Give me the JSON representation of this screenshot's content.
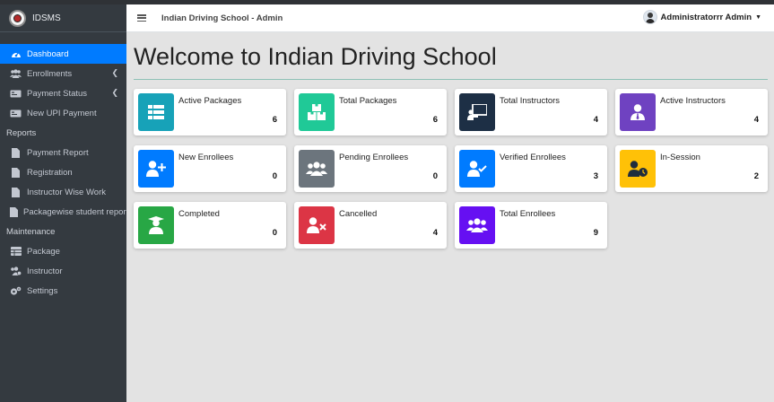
{
  "brand": {
    "name": "IDSMS"
  },
  "sidebar": {
    "items": [
      {
        "label": "Dashboard",
        "icon": "dashboard-icon"
      },
      {
        "label": "Enrollments",
        "icon": "users-icon"
      },
      {
        "label": "Payment Status",
        "icon": "payment-icon"
      },
      {
        "label": "New UPI Payment",
        "icon": "upi-icon"
      }
    ],
    "reports_header": "Reports",
    "reports": [
      {
        "label": "Payment Report",
        "icon": "file-icon"
      },
      {
        "label": "Registration",
        "icon": "file-icon"
      },
      {
        "label": "Instructor Wise Work",
        "icon": "file-icon"
      },
      {
        "label": "Packagewise student report",
        "icon": "file-icon"
      }
    ],
    "maintenance_header": "Maintenance",
    "maintenance": [
      {
        "label": "Package",
        "icon": "table-icon"
      },
      {
        "label": "Instructor",
        "icon": "users-cog-icon"
      },
      {
        "label": "Settings",
        "icon": "cogs-icon"
      }
    ]
  },
  "header": {
    "title": "Indian Driving School - Admin",
    "user": "Administratorrr Admin"
  },
  "main": {
    "title": "Welcome to Indian Driving School",
    "cards": [
      {
        "label": "Active Packages",
        "value": "6",
        "color": "#17a2b8"
      },
      {
        "label": "Total Packages",
        "value": "6",
        "color": "#20c997"
      },
      {
        "label": "Total Instructors",
        "value": "4",
        "color": "#1d2f45"
      },
      {
        "label": "Active Instructors",
        "value": "4",
        "color": "#6f42c1"
      },
      {
        "label": "New Enrollees",
        "value": "0",
        "color": "#007bff"
      },
      {
        "label": "Pending Enrollees",
        "value": "0",
        "color": "#6c757d"
      },
      {
        "label": "Verified Enrollees",
        "value": "3",
        "color": "#007bff"
      },
      {
        "label": "In-Session",
        "value": "2",
        "color": "#ffc107"
      },
      {
        "label": "Completed",
        "value": "0",
        "color": "#28a745"
      },
      {
        "label": "Cancelled",
        "value": "4",
        "color": "#dc3545"
      },
      {
        "label": "Total Enrollees",
        "value": "9",
        "color": "#6610f2"
      }
    ]
  }
}
